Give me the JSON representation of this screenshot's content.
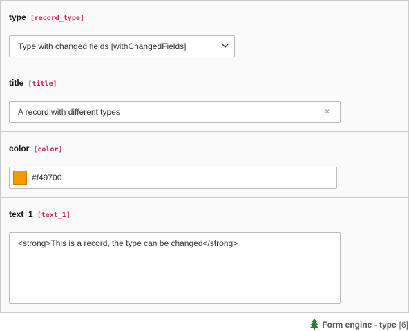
{
  "fields": {
    "type": {
      "label": "type",
      "key": "[record_type]",
      "value": "Type with changed fields [withChangedFields]"
    },
    "title": {
      "label": "title",
      "key": "[title]",
      "value": "A record with different types",
      "clear_icon": "×"
    },
    "color": {
      "label": "color",
      "key": "[color]",
      "value": "#f49700",
      "swatch_color": "#f49700"
    },
    "text_1": {
      "label": "text_1",
      "key": "[text_1]",
      "value": "<strong>This is a record, the type can be changed</strong>"
    }
  },
  "footer": {
    "icon": "tree-icon",
    "name": "Form engine - type",
    "uid": "[6]"
  }
}
